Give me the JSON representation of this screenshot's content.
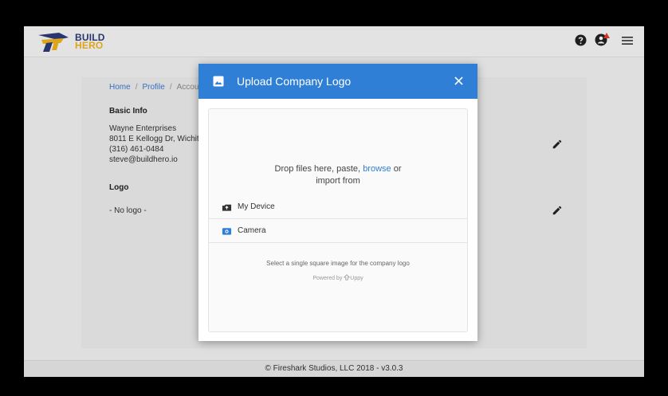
{
  "brand": {
    "line1": "BUILD",
    "line2": "HERO"
  },
  "header_icons": [
    "help-icon",
    "account-alert-icon",
    "menu-icon"
  ],
  "breadcrumb": {
    "home": "Home",
    "sep": "/",
    "profile": "Profile",
    "current": "Account"
  },
  "basic_info": {
    "label": "Basic Info",
    "company": "Wayne Enterprises",
    "address": "8011 E Kellogg Dr, Wichita",
    "phone": "(316) 461-0484",
    "email": "steve@buildhero.io"
  },
  "logo_section": {
    "label": "Logo",
    "value": "- No logo -"
  },
  "footer": {
    "text": "© Fireshark Studios, LLC 2018 - v3.0.3"
  },
  "modal": {
    "title": "Upload Company Logo",
    "drop_text": "Drop files here, paste,",
    "browse": "browse",
    "drop_or": "or",
    "import_from": "import from",
    "sources": [
      "My Device",
      "Camera"
    ],
    "note": "Select a single square image for the company logo",
    "powered_prefix": "Powered by",
    "powered_brand": "Uppy"
  },
  "colors": {
    "primary": "#2f7fd6",
    "brand_navy": "#2d3a78",
    "brand_gold": "#f2b31d"
  }
}
